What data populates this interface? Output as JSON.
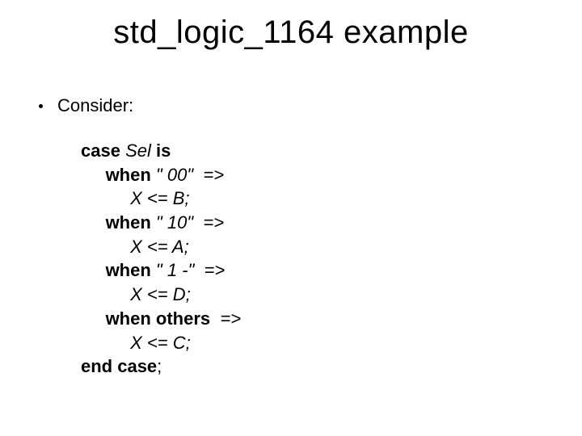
{
  "title": "std_logic_1164 example",
  "bullet": "Consider:",
  "code": {
    "l0": {
      "kw_case": "case",
      "sel": " Sel ",
      "kw_is": "is"
    },
    "l1": {
      "indent": "     ",
      "kw_when": "when",
      "val": " \" 00\" ",
      "arrow": " =>"
    },
    "l2": {
      "indent": "          ",
      "stmt": "X <= B;"
    },
    "l3": {
      "indent": "     ",
      "kw_when": "when",
      "val": " \" 10\" ",
      "arrow": " =>"
    },
    "l4": {
      "indent": "          ",
      "stmt": "X <= A;"
    },
    "l5": {
      "indent": "     ",
      "kw_when": "when",
      "val": " \" 1 -\" ",
      "arrow": " =>"
    },
    "l6": {
      "indent": "          ",
      "stmt": "X <= D;"
    },
    "l7": {
      "indent": "     ",
      "kw_when_others": "when others ",
      "arrow": " =>"
    },
    "l8": {
      "indent": "          ",
      "stmt": "X <= C;"
    },
    "l9": {
      "kw_end": "end case",
      "semi": ";"
    }
  }
}
